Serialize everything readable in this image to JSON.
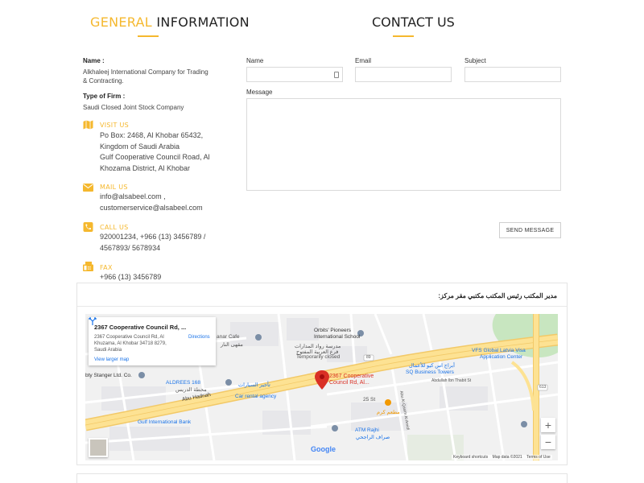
{
  "left": {
    "title_accent": "GENERAL",
    "title_rest": "INFORMATION",
    "name_label": "Name :",
    "name_line1": "Alkhaleej International Company for Trading",
    "name_line2": "& Contracting.",
    "firm_label": "Type of Firm :",
    "firm_value": "Saudi Closed Joint Stock Company",
    "visit": {
      "heading": "VISIT US",
      "lines": [
        "Po Box: 2468, Al Khobar 65432,",
        "Kingdom of Saudi Arabia",
        "Gulf Cooperative Council Road, Al",
        "Khozama District, Al Khobar"
      ]
    },
    "mail": {
      "heading": "MAIL US",
      "lines": [
        "info@alsabeel.com ,",
        "customerservice@alsabeel.com"
      ]
    },
    "call": {
      "heading": "CALL US",
      "lines": [
        "920001234, +966 (13) 3456789 /",
        "4567893/ 5678934"
      ]
    },
    "fax": {
      "heading": "FAX",
      "lines": [
        "+966 (13) 3456789"
      ]
    }
  },
  "contact": {
    "title": "CONTACT US",
    "name_label": "Name",
    "email_label": "Email",
    "subject_label": "Subject",
    "message_label": "Message",
    "send_label": "SEND MESSAGE"
  },
  "map_card": {
    "header": "مدير المكتب رئيس المكتب مكتبي مقر مركز:",
    "info": {
      "title": "2367 Cooperative Council Rd, ...",
      "address": "2367 Cooperative Council Rd, Al Khuzama, Al Khobar 34718 8279, Saudi Arabia",
      "larger_map": "View larger map",
      "directions": "Directions"
    },
    "labels": {
      "nanar": "anar Cafe",
      "nanar_ar": "مقهى النار",
      "orbits1": "Orbits' Pioneers",
      "orbits2": "International School",
      "orbits_ar1": "مدرسة رواد المدارات",
      "orbits_ar2": "فرع العربية المفتوح",
      "temp": "Temporarily closed",
      "vfs1": "VFS Global Latvia Visa",
      "vfs2": "Application Center",
      "sq_ar": "أبراج اس كيو للأعمال",
      "sq": "SQ Business Towers",
      "stanger": "bty Stanger Ltd. Co.",
      "aldrees": "ALDREES 168",
      "aldrees_ar": "محطة الدريس",
      "car_ar": "تأجير السيارات",
      "car": "Car rental agency",
      "marker1": "2367 Cooperative",
      "marker2": "Council Rd, Al...",
      "abu": "Abu Hadriah",
      "gulf_bank": "Gulf International Bank",
      "st25": "25 St",
      "food_ar": "مطعم كرم",
      "atm": "ATM Rajhi",
      "atm_ar": "صراف الراجحي",
      "abdullah": "Abdullah Ibn Thabit St",
      "alqasim": "Abu Al Qasim Al Amidi",
      "route_num": "613",
      "route_num2": "89",
      "google": "Google",
      "attr_shortcuts": "Keyboard shortcuts",
      "attr_data": "Map data ©2021",
      "attr_terms": "Terms of Use",
      "zoom_in": "+",
      "zoom_out": "−"
    }
  },
  "colors": {
    "accent": "#f5b82e",
    "road_major": "#fde293",
    "road_major_edge": "#f2c968",
    "marker": "#d93025",
    "link": "#1a73e8"
  },
  "icons": [
    "map-icon",
    "envelope-icon",
    "phone-icon",
    "fax-icon",
    "directions-icon",
    "map-pin-icon"
  ]
}
